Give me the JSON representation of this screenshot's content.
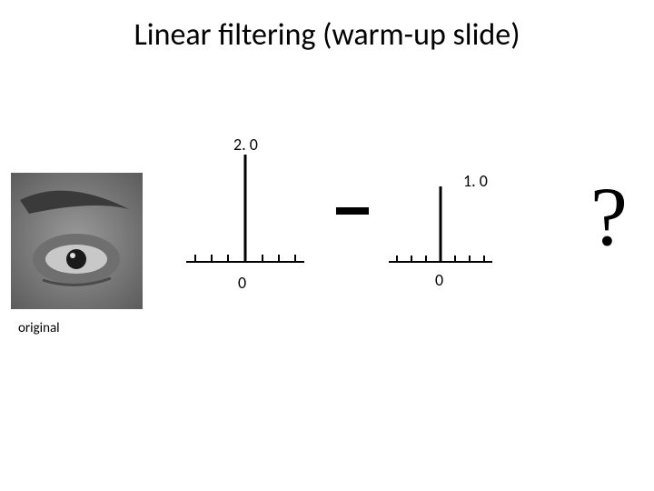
{
  "title": "Linear filtering (warm-up slide)",
  "image_caption": "original",
  "impulse1": {
    "scale": "2. 0",
    "axis_center": "0"
  },
  "impulse2": {
    "scale": "1. 0",
    "axis_center": "0"
  },
  "operator": "–",
  "result": "?"
}
